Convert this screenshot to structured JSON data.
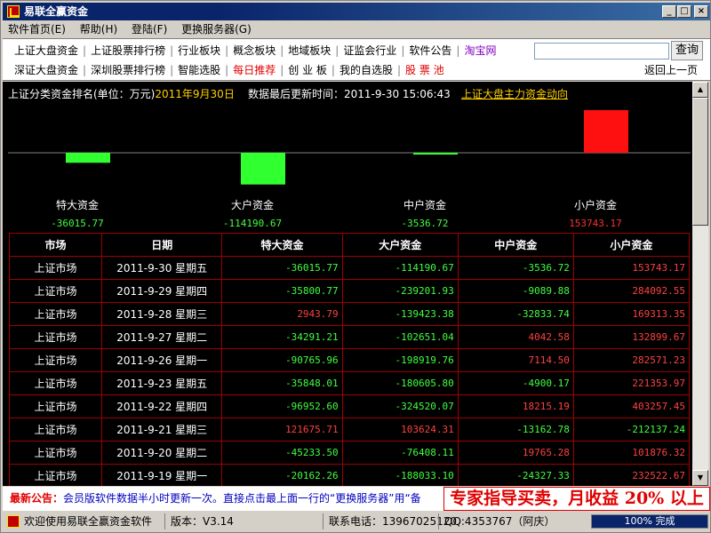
{
  "window": {
    "title": "易联全赢资金",
    "controls": {
      "minimize": "_",
      "maximize": "□",
      "close": "×"
    }
  },
  "menu": [
    "软件首页(E)",
    "帮助(H)",
    "登陆(F)",
    "更换服务器(G)"
  ],
  "nav": {
    "row1": [
      {
        "label": "上证大盘资金",
        "style": "normal"
      },
      {
        "label": "上证股票排行榜",
        "style": "normal"
      },
      {
        "label": "行业板块",
        "style": "normal"
      },
      {
        "label": "概念板块",
        "style": "normal"
      },
      {
        "label": "地域板块",
        "style": "normal"
      },
      {
        "label": "证监会行业",
        "style": "normal"
      },
      {
        "label": "软件公告",
        "style": "normal"
      },
      {
        "label": "淘宝网",
        "style": "purple"
      }
    ],
    "row2": [
      {
        "label": "深证大盘资金",
        "style": "normal"
      },
      {
        "label": "深圳股票排行榜",
        "style": "normal"
      },
      {
        "label": "智能选股",
        "style": "normal"
      },
      {
        "label": "每日推荐",
        "style": "red"
      },
      {
        "label": "创 业 板",
        "style": "normal"
      },
      {
        "label": "我的自选股",
        "style": "normal"
      },
      {
        "label": "股 票 池",
        "style": "red"
      }
    ],
    "search_value": "",
    "search_button": "查询",
    "back_link": "返回上一页"
  },
  "header": {
    "ranking_label": "上证分类资金排名(单位：万元)",
    "ranking_date": "2011年9月30日",
    "update_label": "数据最后更新时间：2011-9-30 15:06:43",
    "trend_link": "上证大盘主力资金动向"
  },
  "chart_data": {
    "type": "bar",
    "categories": [
      "特大资金",
      "大户资金",
      "中户资金",
      "小户资金"
    ],
    "values": [
      -36015.77,
      -114190.67,
      -3536.72,
      153743.17
    ],
    "value_labels": [
      "-36015.77",
      "-114190.67",
      "-3536.72",
      "153743.17"
    ],
    "title": "",
    "xlabel": "",
    "ylabel": "",
    "ylim": [
      -160000,
      160000
    ],
    "colors": {
      "positive": "#ff1010",
      "negative": "#30ff30",
      "axis": "#808080"
    }
  },
  "table": {
    "columns": [
      "市场",
      "日期",
      "特大资金",
      "大户资金",
      "中户资金",
      "小户资金"
    ],
    "rows": [
      [
        "上证市场",
        "2011-9-30  星期五",
        "-36015.77",
        "-114190.67",
        "-3536.72",
        "153743.17"
      ],
      [
        "上证市场",
        "2011-9-29  星期四",
        "-35800.77",
        "-239201.93",
        "-9089.88",
        "284092.55"
      ],
      [
        "上证市场",
        "2011-9-28  星期三",
        "2943.79",
        "-139423.38",
        "-32833.74",
        "169313.35"
      ],
      [
        "上证市场",
        "2011-9-27  星期二",
        "-34291.21",
        "-102651.04",
        "4042.58",
        "132899.67"
      ],
      [
        "上证市场",
        "2011-9-26  星期一",
        "-90765.96",
        "-198919.76",
        "7114.50",
        "282571.23"
      ],
      [
        "上证市场",
        "2011-9-23  星期五",
        "-35848.01",
        "-180605.80",
        "-4900.17",
        "221353.97"
      ],
      [
        "上证市场",
        "2011-9-22  星期四",
        "-96952.60",
        "-324520.07",
        "18215.19",
        "403257.45"
      ],
      [
        "上证市场",
        "2011-9-21  星期三",
        "121675.71",
        "103624.31",
        "-13162.78",
        "-212137.24"
      ],
      [
        "上证市场",
        "2011-9-20  星期二",
        "-45233.50",
        "-76408.11",
        "19765.28",
        "101876.32"
      ],
      [
        "上证市场",
        "2011-9-19  星期一",
        "-20162.26",
        "-188033.10",
        "-24327.33",
        "232522.67"
      ]
    ]
  },
  "notice": {
    "label": "最新公告：",
    "text": "会员版软件数据半小时更新一次。直接点击最上面一行的“更换服务器”用“备",
    "promo": "专家指导买卖，月收益 20% 以上"
  },
  "status": {
    "welcome": "欢迎使用易联全赢资金软件",
    "version": "版本：V3.14",
    "phone": "联系电话：13967025120",
    "qq": "QQ:4353767（阿庆）",
    "progress_text": "100% 完成",
    "progress_fraction": 1.0
  }
}
